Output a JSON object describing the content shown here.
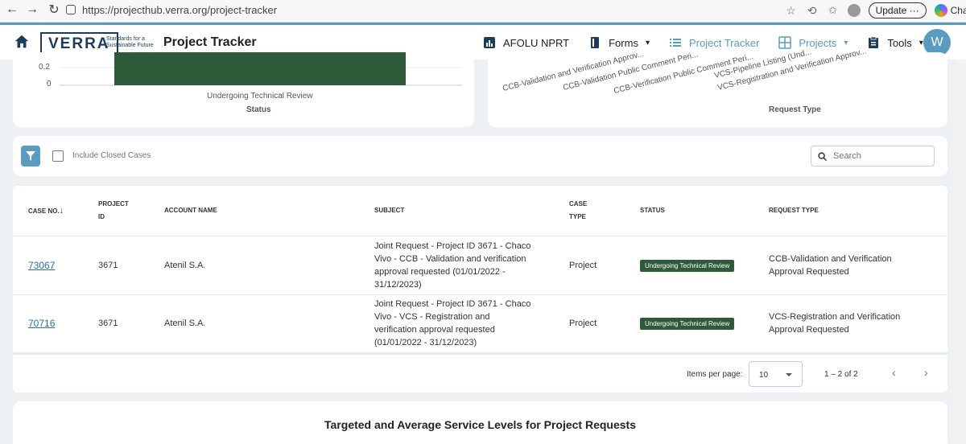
{
  "browser": {
    "url": "https://projecthub.verra.org/project-tracker",
    "update_label": "Update",
    "update_dots": "···",
    "chat_label": "Chat"
  },
  "header": {
    "logo_text": "VERRA",
    "logo_tagline": "Standards for a Sustainable Future",
    "title": "Project Tracker",
    "nav": [
      {
        "label": "AFOLU NPRT",
        "icon": "bar-chart-icon"
      },
      {
        "label": "Forms",
        "icon": "book-icon",
        "has_dropdown": true
      },
      {
        "label": "Project Tracker",
        "icon": "list-icon",
        "active": true
      },
      {
        "label": "Projects",
        "icon": "grid-icon",
        "has_dropdown": true
      },
      {
        "label": "Tools",
        "icon": "clipboard-icon",
        "has_dropdown": true
      }
    ],
    "user_initial": "W",
    "accent_color": "#5a9bc0"
  },
  "chart_data": [
    {
      "type": "bar",
      "categories": [
        "Undergoing Technical Review"
      ],
      "values": [
        1
      ],
      "xlabel": "Status",
      "ylabel": "",
      "visible_ticks": [
        "0.2",
        "0"
      ],
      "bar_color": "#2f5a3a"
    },
    {
      "type": "bar",
      "categories": [
        "CCB-Validation and Verification Approv...",
        "CCB-Validation Public Comment Peri...",
        "CCB-Verification Public Comment Peri...",
        "VCS-Pipeline Listing (Und...",
        "VCS-Registration and Verification Approv..."
      ],
      "xlabel": "Request Type"
    }
  ],
  "filter": {
    "include_closed_label": "Include Closed Cases",
    "search_placeholder": "Search"
  },
  "table": {
    "headers": {
      "case_no": "CASE NO.",
      "project_id_1": "PROJECT",
      "project_id_2": "ID",
      "account_name": "ACCOUNT NAME",
      "subject": "SUBJECT",
      "case_type_1": "CASE",
      "case_type_2": "TYPE",
      "status": "STATUS",
      "request_type": "REQUEST TYPE"
    },
    "rows": [
      {
        "case_no": "73067",
        "project_id": "3671",
        "account_name": "Atenil S.A.",
        "subject_lines": [
          "Joint Request - Project ID 3671 - Chaco",
          "Vivo - CCB - Validation and verification",
          "approval requested (01/01/2022 -",
          "31/12/2023)"
        ],
        "case_type": "Project",
        "status": "Undergoing Technical Review",
        "request_type_lines": [
          "CCB-Validation and Verification",
          "Approval Requested"
        ]
      },
      {
        "case_no": "70716",
        "project_id": "3671",
        "account_name": "Atenil S.A.",
        "subject_lines": [
          "Joint Request - Project ID 3671 - Chaco",
          "Vivo - VCS - Registration and",
          "verification approval requested",
          "(01/01/2022 - 31/12/2023)"
        ],
        "case_type": "Project",
        "status": "Undergoing Technical Review",
        "request_type_lines": [
          "VCS-Registration and Verification",
          "Approval Requested"
        ]
      }
    ],
    "pagination": {
      "items_per_page_label": "Items per page:",
      "items_per_page_value": "10",
      "range_label": "1 – 2 of 2"
    }
  },
  "service_levels": {
    "title": "Targeted and Average Service Levels for Project Requests"
  }
}
